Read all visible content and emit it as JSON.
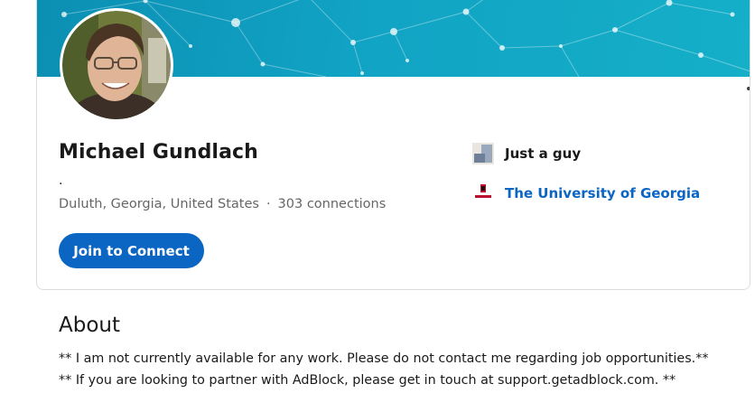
{
  "profile": {
    "name": "Michael Gundlach",
    "headline": ".",
    "location": "Duluth, Georgia, United States",
    "separator": "·",
    "connections": "303 connections",
    "connect_label": "Join to Connect",
    "avatar_alt": "profile-photo"
  },
  "side": {
    "current_company": "Just a guy",
    "education": "The University of Georgia"
  },
  "about": {
    "title": "About",
    "lines": [
      "** I am not currently available for any work. Please do not contact me regarding job opportunities.**",
      "** If you are looking to partner with AdBlock, please get in touch at support.getadblock.com. **"
    ]
  },
  "colors": {
    "accent": "#0a66c2",
    "banner": "#11a3c4"
  },
  "icons": {
    "more": "more-horizontal-icon",
    "company": "company-logo-icon",
    "school": "university-logo-icon"
  }
}
